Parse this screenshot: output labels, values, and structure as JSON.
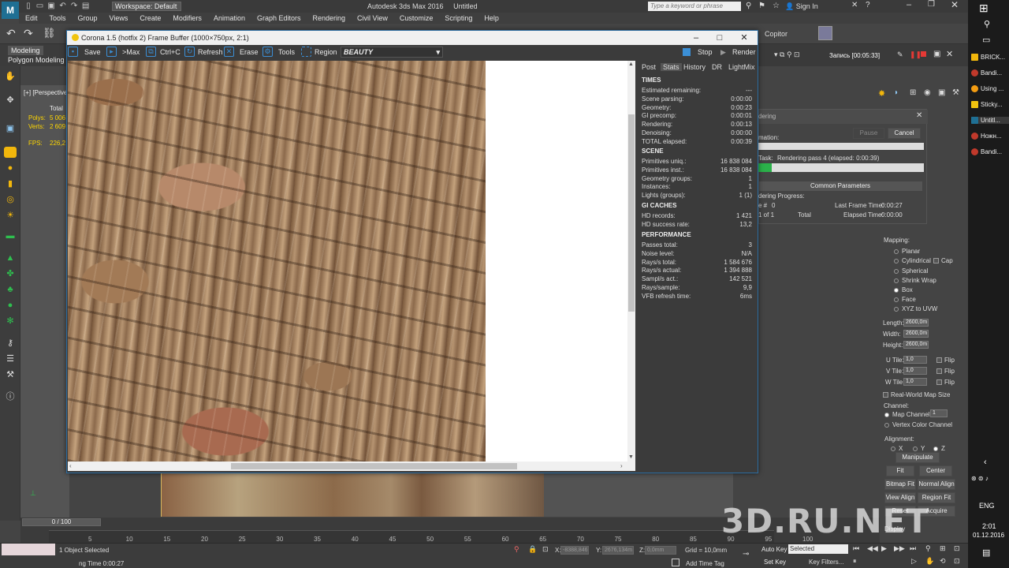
{
  "app": {
    "title": "Autodesk 3ds Max 2016",
    "document": "Untitled",
    "workspace": "Workspace: Default",
    "search_placeholder": "Type a keyword or phrase",
    "sign_in": "Sign In",
    "menu": [
      "Edit",
      "Tools",
      "Group",
      "Views",
      "Create",
      "Modifiers",
      "Animation",
      "Graph Editors",
      "Rendering",
      "Civil View",
      "Customize",
      "Scripting",
      "Help"
    ],
    "ribbon_tabs": [
      "Modeling",
      "Polygon Modeling"
    ],
    "copitor": "Copitor"
  },
  "viewport": {
    "label": "[+] [Perspective",
    "stats": {
      "total": "Total",
      "polys_label": "Polys:",
      "polys": "5 006",
      "verts_label": "Verts:",
      "verts": "2 609",
      "fps_label": "FPS:",
      "fps": "226,2"
    }
  },
  "vfb": {
    "title": "Corona 1.5 (hotfix 2) Frame Buffer (1000×750px, 2:1)",
    "toolbar": {
      "save": "Save",
      "max": ">Max",
      "ctrlc": "Ctrl+C",
      "refresh": "Refresh",
      "erase": "Erase",
      "tools": "Tools",
      "region": "Region",
      "channel": "BEAUTY",
      "stop": "Stop",
      "render": "Render"
    },
    "tabs": [
      "Post",
      "Stats",
      "History",
      "DR",
      "LightMix"
    ],
    "stats": {
      "times_header": "TIMES",
      "times": [
        {
          "label": "Estimated remaining:",
          "value": "---"
        },
        {
          "label": "Scene parsing:",
          "value": "0:00:00"
        },
        {
          "label": "Geometry:",
          "value": "0:00:23"
        },
        {
          "label": "GI precomp:",
          "value": "0:00:01"
        },
        {
          "label": "Rendering:",
          "value": "0:00:13"
        },
        {
          "label": "Denoising:",
          "value": "0:00:00"
        },
        {
          "label": "TOTAL elapsed:",
          "value": "0:00:39"
        }
      ],
      "scene_header": "SCENE",
      "scene": [
        {
          "label": "Primitives uniq.:",
          "value": "16 838 084"
        },
        {
          "label": "Primitives inst.:",
          "value": "16 838 084"
        },
        {
          "label": "Geometry groups:",
          "value": "1"
        },
        {
          "label": "Instances:",
          "value": "1"
        },
        {
          "label": "Lights (groups):",
          "value": "1 (1)"
        }
      ],
      "gi_header": "GI CACHES",
      "gi": [
        {
          "label": "HD records:",
          "value": "1 421"
        },
        {
          "label": "HD success rate:",
          "value": "13,2"
        }
      ],
      "perf_header": "PERFORMANCE",
      "perf": [
        {
          "label": "Passes total:",
          "value": "3"
        },
        {
          "label": "Noise level:",
          "value": "N/A"
        },
        {
          "label": "Rays/s total:",
          "value": "1 584 676"
        },
        {
          "label": "Rays/s actual:",
          "value": "1 394 888"
        },
        {
          "label": "Sampl/s act.:",
          "value": "142 521"
        },
        {
          "label": "Rays/sample:",
          "value": "9,9"
        },
        {
          "label": "VFB refresh time:",
          "value": "6ms"
        }
      ]
    }
  },
  "render_dialog": {
    "title": "dering",
    "animation": "mation:",
    "pause": "Pause",
    "cancel": "Cancel",
    "task": "Task:",
    "task_text": "Rendering pass 4 (elapsed: 0:00:39)",
    "progress": 0.08,
    "common_params": "Common Parameters",
    "rendering_progress": "dering Progress:",
    "frame": "e #",
    "frame_val": "0",
    "of": "1 of 1",
    "total": "Total",
    "last_frame_label": "Last Frame Time:",
    "last_frame": "0:00:27",
    "elapsed_label": "Elapsed Time:",
    "elapsed": "0:00:00"
  },
  "recording": "Запись [00:05:33]",
  "command_panel": {
    "mapping_label": "Mapping:",
    "mapping_options": [
      "Planar",
      "Cylindrical",
      "Spherical",
      "Shrink Wrap",
      "Box",
      "Face",
      "XYZ to UVW"
    ],
    "mapping_selected": "Box",
    "cap": "Cap",
    "length_label": "Length:",
    "length": "2600,0m",
    "width_label": "Width:",
    "width": "2600,0m",
    "height_label": "Height:",
    "height": "2600,0m",
    "utile_label": "U Tile:",
    "utile": "1,0",
    "vtile_label": "V Tile:",
    "vtile": "1,0",
    "wtile_label": "W Tile:",
    "wtile": "1,0",
    "flip": "Flip",
    "real_world": "Real-World Map Size",
    "channel_label": "Channel:",
    "map_channel": "Map Channel:",
    "map_channel_val": "1",
    "vertex_color": "Vertex Color Channel",
    "alignment": "Alignment:",
    "axes": [
      "X",
      "Y",
      "Z"
    ],
    "manipulate": "Manipulate",
    "fit": "Fit",
    "center": "Center",
    "bitmap_fit": "Bitmap Fit",
    "normal_align": "Normal Align",
    "view_align": "View Align",
    "region_fit": "Region Fit",
    "reset": "Reset",
    "acquire": "Acquire",
    "display": "Display"
  },
  "timeline": {
    "slider": "0 / 100",
    "ticks": [
      "5",
      "10",
      "15",
      "20",
      "25",
      "30",
      "35",
      "40",
      "45",
      "50",
      "55",
      "60",
      "65",
      "70",
      "75",
      "80",
      "85",
      "90",
      "95",
      "100"
    ]
  },
  "status": {
    "selection": "1 Object Selected",
    "render_time": "ng Time  0:00:27",
    "x_label": "X:",
    "x": "-8388,846",
    "y_label": "Y:",
    "y": "2676,134m",
    "z_label": "Z:",
    "z": "0,0mm",
    "grid": "Grid = 10,0mm",
    "add_time_tag": "Add Time Tag",
    "auto_key": "Auto Key",
    "selected": "Selected",
    "set_key": "Set Key",
    "key_filters": "Key Filters..."
  },
  "taskbar": {
    "items": [
      "BRICK...",
      "Bandi...",
      "Using ...",
      "Sticky...",
      "Untitl...",
      "Ножн...",
      "Bandi..."
    ],
    "lang": "ENG",
    "time": "2:01",
    "date": "01.12.2016"
  },
  "watermark": "3D.RU.NET"
}
